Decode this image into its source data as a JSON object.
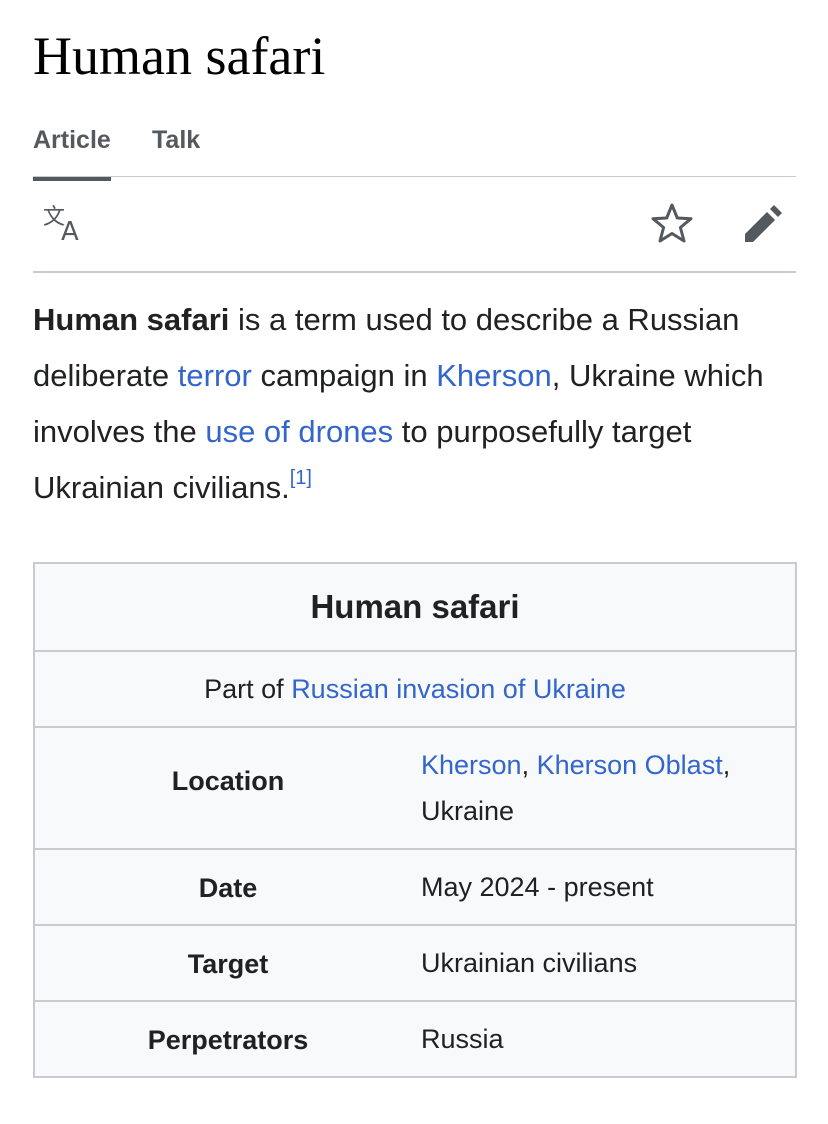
{
  "page": {
    "title": "Human safari"
  },
  "tabs": [
    {
      "label": "Article",
      "active": true
    },
    {
      "label": "Talk",
      "active": false
    }
  ],
  "toolbar": {
    "icons": [
      "language-icon",
      "star-icon",
      "edit-pencil-icon"
    ]
  },
  "lead": {
    "bold_term": "Human safari",
    "text_1": " is a term used to describe a Russian deliberate ",
    "link_terror": "terror",
    "text_2": " campaign in ",
    "link_kherson": "Kherson",
    "text_3": ", Ukraine which involves the ",
    "link_drones": "use of drones",
    "text_4": " to purposefully target Ukrainian civilians.",
    "ref": "[1]"
  },
  "infobox": {
    "title": "Human safari",
    "part_of_prefix": "Part of ",
    "part_of_link": "Russian invasion of Ukraine",
    "rows": [
      {
        "label": "Location",
        "link_1": "Kherson",
        "sep": ", ",
        "link_2": "Kherson Oblast",
        "tail": ", Ukraine"
      },
      {
        "label": "Date",
        "value": "May 2024 - present"
      },
      {
        "label": "Target",
        "value": "Ukrainian civilians"
      },
      {
        "label": "Perpetrators",
        "value": "Russia"
      }
    ]
  },
  "colors": {
    "link": "#3366cc",
    "text": "#202122",
    "border": "#c8ccd1",
    "infobox_bg": "#f8f9fa",
    "icon": "#54595d"
  }
}
